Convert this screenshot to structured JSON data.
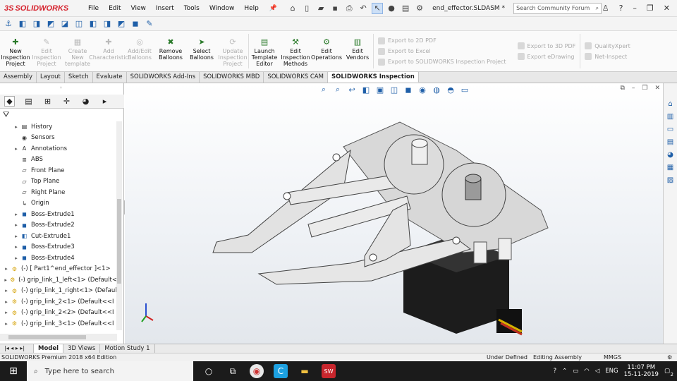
{
  "app": {
    "logo_text": "SOLIDWORKS",
    "filename": "end_effector.SLDASM *"
  },
  "menu": [
    "File",
    "Edit",
    "View",
    "Insert",
    "Tools",
    "Window",
    "Help"
  ],
  "search": {
    "placeholder": "Search Community Forum"
  },
  "ribbon": {
    "buttons": [
      {
        "label": "New Inspection Project",
        "enabled": true
      },
      {
        "label": "Edit Inspection Project",
        "enabled": false
      },
      {
        "label": "Create New template",
        "enabled": false
      },
      {
        "label": "Add Characteristic",
        "enabled": false
      },
      {
        "label": "Add/Edit Balloons",
        "enabled": false
      },
      {
        "label": "Remove Balloons",
        "enabled": true
      },
      {
        "label": "Select Balloons",
        "enabled": true
      },
      {
        "label": "Update Inspection Project",
        "enabled": false
      },
      {
        "label": "Launch Template Editor",
        "enabled": true
      },
      {
        "label": "Edit Inspection Methods",
        "enabled": true
      },
      {
        "label": "Edit Operations",
        "enabled": true
      },
      {
        "label": "Edit Vendors",
        "enabled": true
      }
    ],
    "export_col1": [
      "Export to 2D PDF",
      "Export to Excel",
      "Export to SOLIDWORKS Inspection Project"
    ],
    "export_col2": [
      "Export to 3D PDF",
      "Export eDrawing"
    ],
    "export_col3": [
      "QualityXpert",
      "Net-Inspect"
    ]
  },
  "tabs": [
    "Assembly",
    "Layout",
    "Sketch",
    "Evaluate",
    "SOLIDWORKS Add-Ins",
    "SOLIDWORKS MBD",
    "SOLIDWORKS CAM",
    "SOLIDWORKS Inspection"
  ],
  "active_tab": "SOLIDWORKS Inspection",
  "tree": [
    {
      "label": "History",
      "indent": 1,
      "arrow": true,
      "icon": "history-icon"
    },
    {
      "label": "Sensors",
      "indent": 1,
      "arrow": false,
      "icon": "sensor-icon"
    },
    {
      "label": "Annotations",
      "indent": 1,
      "arrow": true,
      "icon": "annotation-icon"
    },
    {
      "label": "ABS",
      "indent": 1,
      "arrow": false,
      "icon": "material-icon"
    },
    {
      "label": "Front Plane",
      "indent": 1,
      "arrow": false,
      "icon": "plane-icon"
    },
    {
      "label": "Top Plane",
      "indent": 1,
      "arrow": false,
      "icon": "plane-icon"
    },
    {
      "label": "Right Plane",
      "indent": 1,
      "arrow": false,
      "icon": "plane-icon"
    },
    {
      "label": "Origin",
      "indent": 1,
      "arrow": false,
      "icon": "origin-icon"
    },
    {
      "label": "Boss-Extrude1",
      "indent": 1,
      "arrow": true,
      "icon": "feature-icon"
    },
    {
      "label": "Boss-Extrude2",
      "indent": 1,
      "arrow": true,
      "icon": "feature-icon"
    },
    {
      "label": "Cut-Extrude1",
      "indent": 1,
      "arrow": true,
      "icon": "cut-icon"
    },
    {
      "label": "Boss-Extrude3",
      "indent": 1,
      "arrow": true,
      "icon": "feature-icon"
    },
    {
      "label": "Boss-Extrude4",
      "indent": 1,
      "arrow": true,
      "icon": "feature-icon"
    },
    {
      "label": "(-) [ Part1^end_effector ]<1>",
      "indent": 0,
      "arrow": true,
      "icon": "part-icon"
    },
    {
      "label": "(-) grip_link_1_left<1> (Default<",
      "indent": 0,
      "arrow": true,
      "icon": "part-icon"
    },
    {
      "label": "(-) grip_link_1_right<1> (Defaul",
      "indent": 0,
      "arrow": true,
      "icon": "part-icon"
    },
    {
      "label": "(-) grip_link_2<1> (Default<<I",
      "indent": 0,
      "arrow": true,
      "icon": "part-icon"
    },
    {
      "label": "(-) grip_link_2<2> (Default<<I",
      "indent": 0,
      "arrow": true,
      "icon": "part-icon"
    },
    {
      "label": "(-) grip_link_3<1> (Default<<I",
      "indent": 0,
      "arrow": true,
      "icon": "part-icon"
    }
  ],
  "bottom_tabs": [
    "Model",
    "3D Views",
    "Motion Study 1"
  ],
  "status": {
    "left": "SOLIDWORKS Premium 2018 x64 Edition",
    "s1": "Under Defined",
    "s2": "Editing Assembly",
    "units": "MMGS"
  },
  "taskbar": {
    "search_placeholder": "Type here to search",
    "lang": "ENG",
    "time": "11:07 PM",
    "date": "15-11-2019",
    "notif": "2"
  }
}
